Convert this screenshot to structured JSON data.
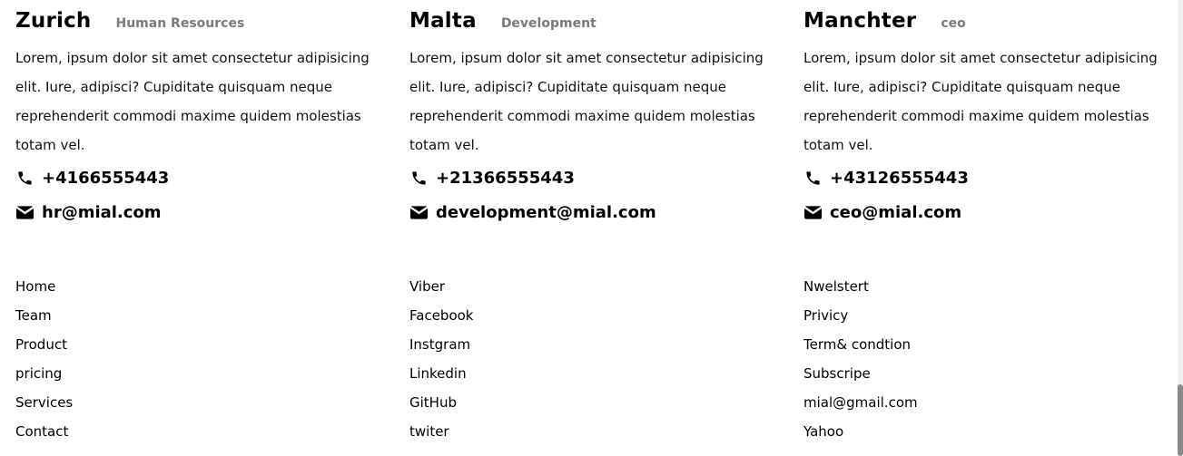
{
  "offices": [
    {
      "city": "Zurich",
      "department": "Human Resources",
      "description": "Lorem, ipsum dolor sit amet consectetur adipisicing elit. Iure, adipisci? Cupiditate quisquam neque reprehenderit commodi maxime quidem molestias totam vel.",
      "phone": "+4166555443",
      "email": "hr@mial.com"
    },
    {
      "city": "Malta",
      "department": "Development",
      "description": "Lorem, ipsum dolor sit amet consectetur adipisicing elit. Iure, adipisci? Cupiditate quisquam neque reprehenderit commodi maxime quidem molestias totam vel.",
      "phone": "+21366555443",
      "email": "development@mial.com"
    },
    {
      "city": "Manchter",
      "department": "ceo",
      "description": "Lorem, ipsum dolor sit amet consectetur adipisicing elit. Iure, adipisci? Cupiditate quisquam neque reprehenderit commodi maxime quidem molestias totam vel.",
      "phone": "+43126555443",
      "email": "ceo@mial.com"
    }
  ],
  "icons": {
    "phone": "phone-icon",
    "email": "envelope-icon"
  },
  "footer_links": {
    "column1": [
      "Home",
      "Team",
      "Product",
      "pricing",
      "Services",
      "Contact"
    ],
    "column2": [
      "Viber",
      "Facebook",
      "Instgram",
      "Linkedin",
      "GitHub",
      "twiter"
    ],
    "column3": [
      "Nwelstert",
      "Privicy",
      "Term& condtion",
      "Subscripe",
      "mial@gmail.com",
      "Yahoo"
    ]
  },
  "colors": {
    "text": "#000000",
    "department": "#7a7a7a",
    "background": "#ffffff"
  }
}
